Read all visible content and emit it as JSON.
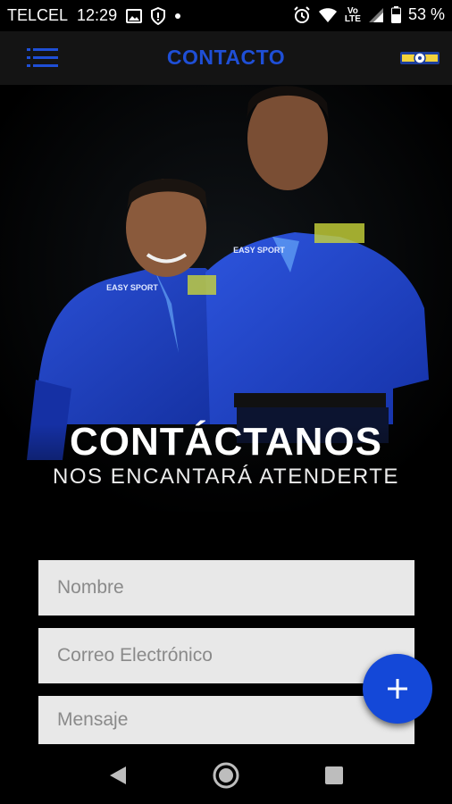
{
  "status_bar": {
    "carrier": "TELCEL",
    "time": "12:29",
    "volte_top": "Vo",
    "volte_bottom": "LTE",
    "battery": "53 %"
  },
  "app_bar": {
    "title": "CONTACTO"
  },
  "hero": {
    "title": "CONTÁCTANOS",
    "subtitle": "NOS ENCANTARÁ ATENDERTE",
    "shirt_brand": "EASY SPORT"
  },
  "form": {
    "name_placeholder": "Nombre",
    "email_placeholder": "Correo Electrónico",
    "message_placeholder": "Mensaje"
  },
  "colors": {
    "accent": "#1f4fd6",
    "fab": "#1448d8",
    "field_bg": "#e8e8e8",
    "appbar_bg": "#141414"
  }
}
